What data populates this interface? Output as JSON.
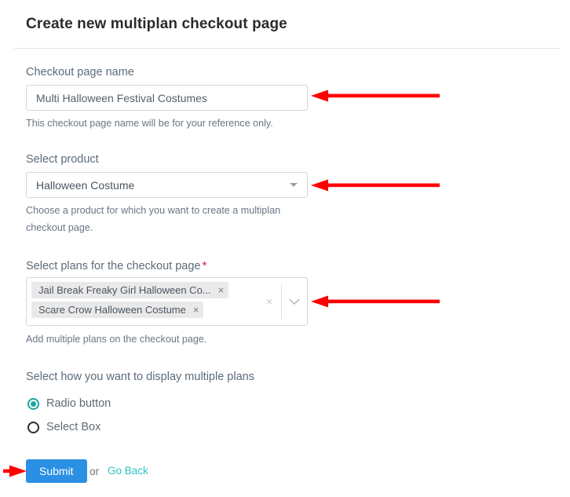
{
  "header": {
    "title": "Create new multiplan checkout page"
  },
  "form": {
    "checkout_name": {
      "label": "Checkout page name",
      "value": "Multi Halloween Festival Costumes",
      "placeholder": "",
      "helper": "This checkout page name will be for your reference only."
    },
    "product": {
      "label": "Select product",
      "value": "Halloween Costume",
      "helper": "Choose a product for which you want to create a multiplan checkout page."
    },
    "plans": {
      "label": "Select plans for the checkout page",
      "required_marker": "*",
      "chips": [
        {
          "label": "Jail Break Freaky Girl Halloween Co...",
          "remove": "×"
        },
        {
          "label": "Scare Crow Halloween Costume",
          "remove": "×"
        }
      ],
      "clear_all": "×",
      "helper": "Add multiple plans on the checkout page."
    },
    "display_mode": {
      "label": "Select how you want to display multiple plans",
      "options": [
        {
          "label": "Radio button",
          "selected": true
        },
        {
          "label": "Select Box",
          "selected": false
        }
      ]
    },
    "actions": {
      "submit_label": "Submit",
      "or_label": "or",
      "go_back_label": "Go Back"
    }
  },
  "colors": {
    "submit_blue": "#2b90e4",
    "link_teal": "#2ec4c4",
    "radio_teal": "#1aa69a",
    "required_red": "#e8174a",
    "annotation_red": "#ff0000",
    "chip_bg": "#e9e9e9"
  }
}
